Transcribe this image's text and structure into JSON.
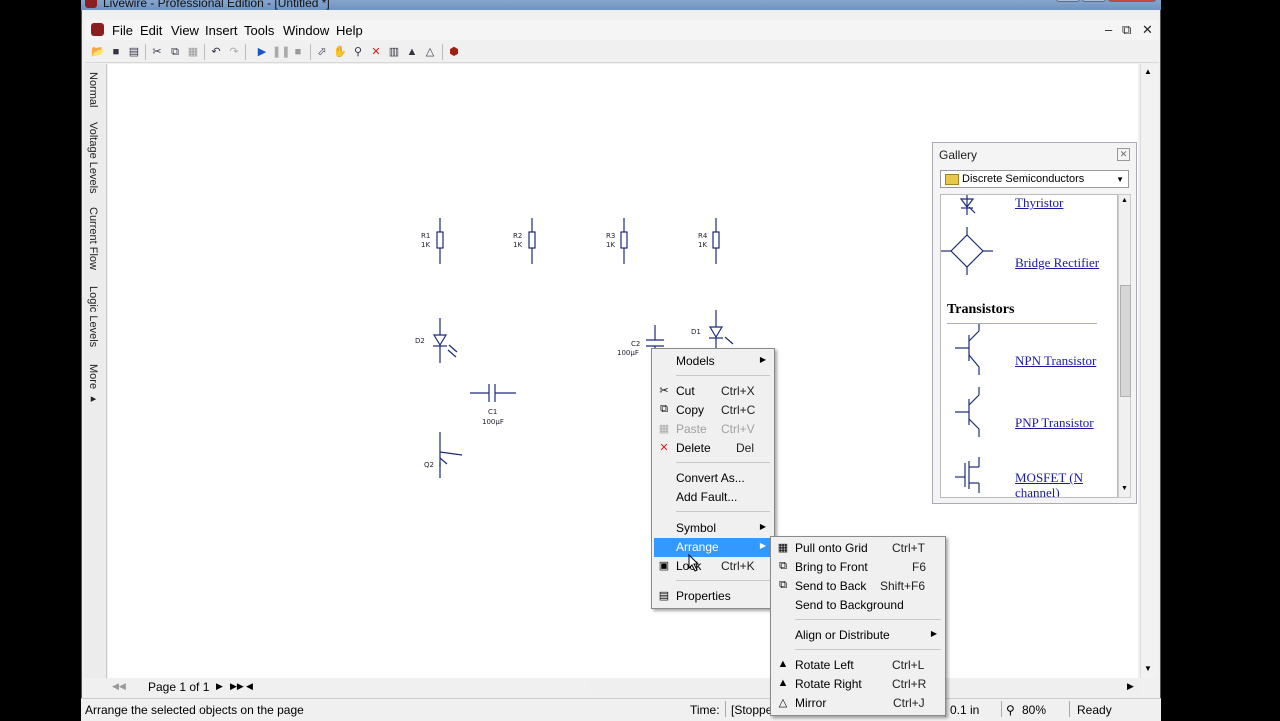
{
  "window": {
    "title": "Livewire - Professional Edition - [Untitled *]"
  },
  "menubar": {
    "items": [
      "File",
      "Edit",
      "View",
      "Insert",
      "Tools",
      "Window",
      "Help"
    ]
  },
  "left_tabs": [
    "Normal",
    "Voltage Levels",
    "Current Flow",
    "Logic Levels",
    "More ▸"
  ],
  "components": {
    "r1": {
      "ref": "R1",
      "value": "1K"
    },
    "r2": {
      "ref": "R2",
      "value": "1K"
    },
    "r3": {
      "ref": "R3",
      "value": "1K"
    },
    "r4": {
      "ref": "R4",
      "value": "1K"
    },
    "d2": {
      "ref": "D2"
    },
    "d1": {
      "ref": "D1"
    },
    "c1": {
      "ref": "C1",
      "value": "100µF"
    },
    "c2": {
      "ref": "C2",
      "value": "100µF"
    },
    "q2": {
      "ref": "Q2"
    }
  },
  "gallery": {
    "title": "Gallery",
    "category": "Discrete Semiconductors",
    "section": "Transistors",
    "items": [
      "Thyristor",
      "Bridge Rectifier",
      "NPN Transistor",
      "PNP Transistor",
      "MOSFET (N channel)"
    ]
  },
  "context_menu": {
    "models": "Models",
    "cut": {
      "label": "Cut",
      "shortcut": "Ctrl+X"
    },
    "copy": {
      "label": "Copy",
      "shortcut": "Ctrl+C"
    },
    "paste": {
      "label": "Paste",
      "shortcut": "Ctrl+V"
    },
    "delete": {
      "label": "Delete",
      "shortcut": "Del"
    },
    "convert_as": "Convert As...",
    "add_fault": "Add Fault...",
    "symbol": "Symbol",
    "arrange": "Arrange",
    "lock": {
      "label": "Lock",
      "shortcut": "Ctrl+K"
    },
    "properties": "Properties"
  },
  "arrange_submenu": {
    "pull_onto_grid": {
      "label": "Pull onto Grid",
      "shortcut": "Ctrl+T"
    },
    "bring_to_front": {
      "label": "Bring to Front",
      "shortcut": "F6"
    },
    "send_to_back": {
      "label": "Send to Back",
      "shortcut": "Shift+F6"
    },
    "send_to_background": {
      "label": "Send to Background"
    },
    "align_or_distribute": {
      "label": "Align or Distribute"
    },
    "rotate_left": {
      "label": "Rotate Left",
      "shortcut": "Ctrl+L"
    },
    "rotate_right": {
      "label": "Rotate Right",
      "shortcut": "Ctrl+R"
    },
    "mirror": {
      "label": "Mirror",
      "shortcut": "Ctrl+J"
    }
  },
  "pagebar": {
    "label": "Page 1 of 1"
  },
  "statusbar": {
    "message": "Arrange the selected objects on the page",
    "time_label": "Time:",
    "time_value": "[Stoppe",
    "grid": "0.1 in",
    "zoom": "80%",
    "state": "Ready"
  },
  "colors": {
    "highlight": "#3399ff",
    "link": "#1a1aa6",
    "component": "#1c2a7a"
  }
}
